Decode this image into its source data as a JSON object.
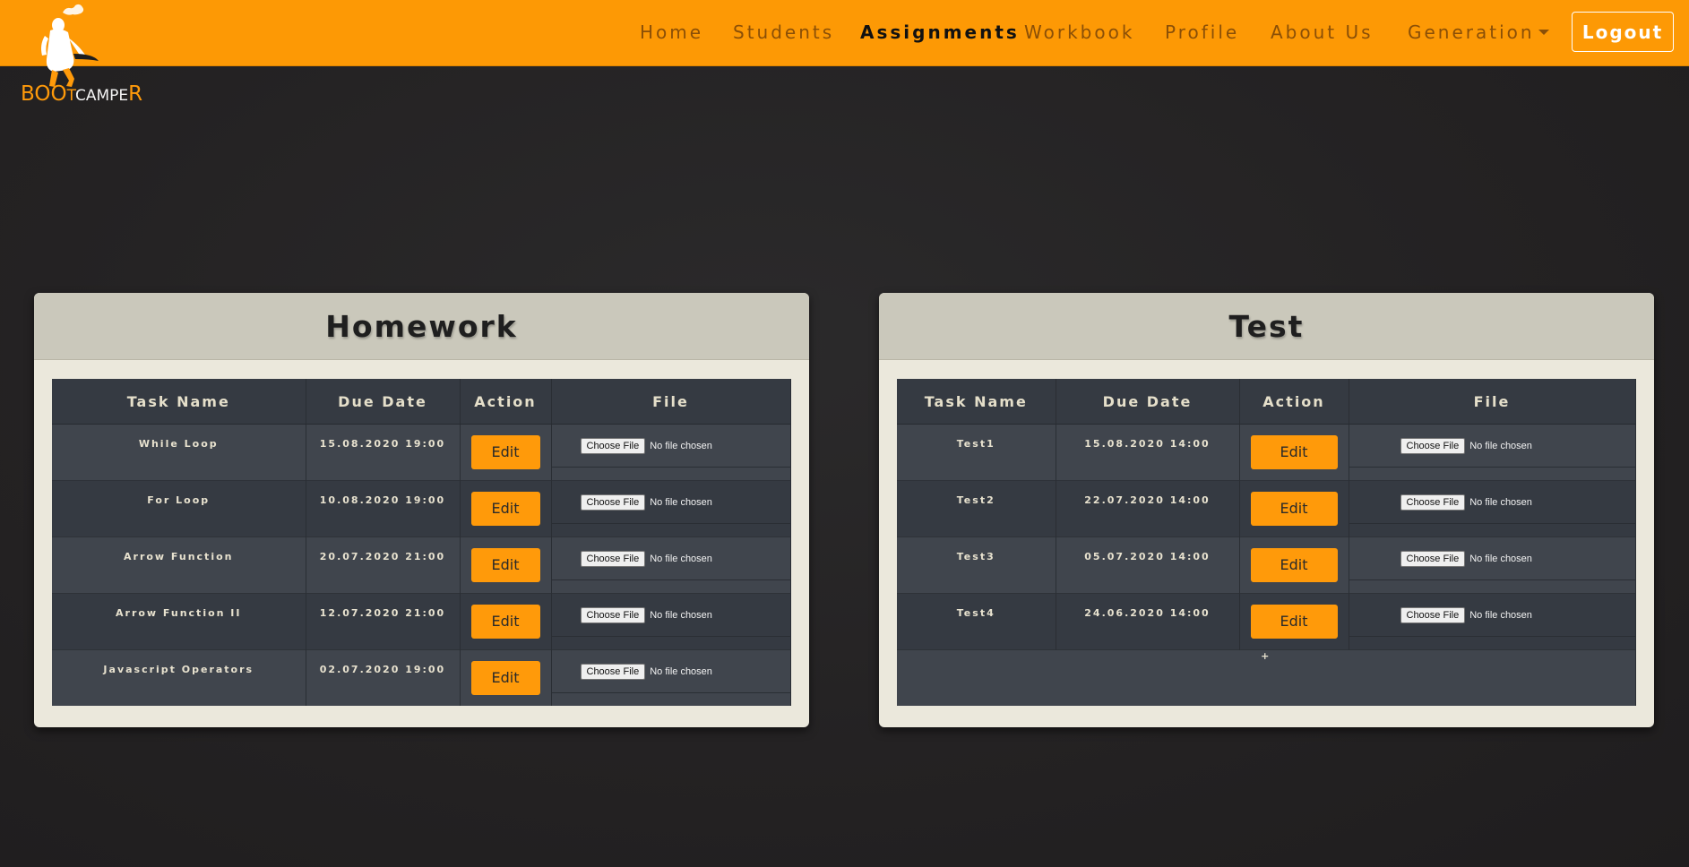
{
  "brand": {
    "name_part1": "BOO",
    "name_part2": "T",
    "name_part3": "CAMPE",
    "name_part4": "R"
  },
  "nav": {
    "items": [
      "Home",
      "Students",
      "Assignments",
      "Workbook",
      "Profile",
      "About Us"
    ],
    "dropdown_label": "Generation",
    "logout_label": "Logout",
    "active": "Assignments"
  },
  "homework": {
    "title": "Homework",
    "columns": [
      "Task Name",
      "Due Date",
      "Action",
      "File"
    ],
    "rows": [
      {
        "task": "While Loop",
        "due": "15.08.2020 19:00",
        "action": "Edit",
        "file_button": "Choose File",
        "file_status": "No file chosen"
      },
      {
        "task": "For Loop",
        "due": "10.08.2020 19:00",
        "action": "Edit",
        "file_button": "Choose File",
        "file_status": "No file chosen"
      },
      {
        "task": "Arrow Function",
        "due": "20.07.2020 21:00",
        "action": "Edit",
        "file_button": "Choose File",
        "file_status": "No file chosen"
      },
      {
        "task": "Arrow Function II",
        "due": "12.07.2020 21:00",
        "action": "Edit",
        "file_button": "Choose File",
        "file_status": "No file chosen"
      },
      {
        "task": "Javascript Operators",
        "due": "02.07.2020 19:00",
        "action": "Edit",
        "file_button": "Choose File",
        "file_status": "No file chosen"
      }
    ]
  },
  "test": {
    "title": "Test",
    "columns": [
      "Task Name",
      "Due Date",
      "Action",
      "File"
    ],
    "rows": [
      {
        "task": "Test1",
        "due": "15.08.2020 14:00",
        "action": "Edit",
        "file_button": "Choose File",
        "file_status": "No file chosen"
      },
      {
        "task": "Test2",
        "due": "22.07.2020 14:00",
        "action": "Edit",
        "file_button": "Choose File",
        "file_status": "No file chosen"
      },
      {
        "task": "Test3",
        "due": "05.07.2020 14:00",
        "action": "Edit",
        "file_button": "Choose File",
        "file_status": "No file chosen"
      },
      {
        "task": "Test4",
        "due": "24.06.2020 14:00",
        "action": "Edit",
        "file_button": "Choose File",
        "file_status": "No file chosen"
      }
    ],
    "add_label": "+"
  },
  "colors": {
    "accent": "#fd9905",
    "background": "#232122",
    "card": "#ebe8dc",
    "table_dark": "#353a42",
    "table_light": "#40454d"
  }
}
